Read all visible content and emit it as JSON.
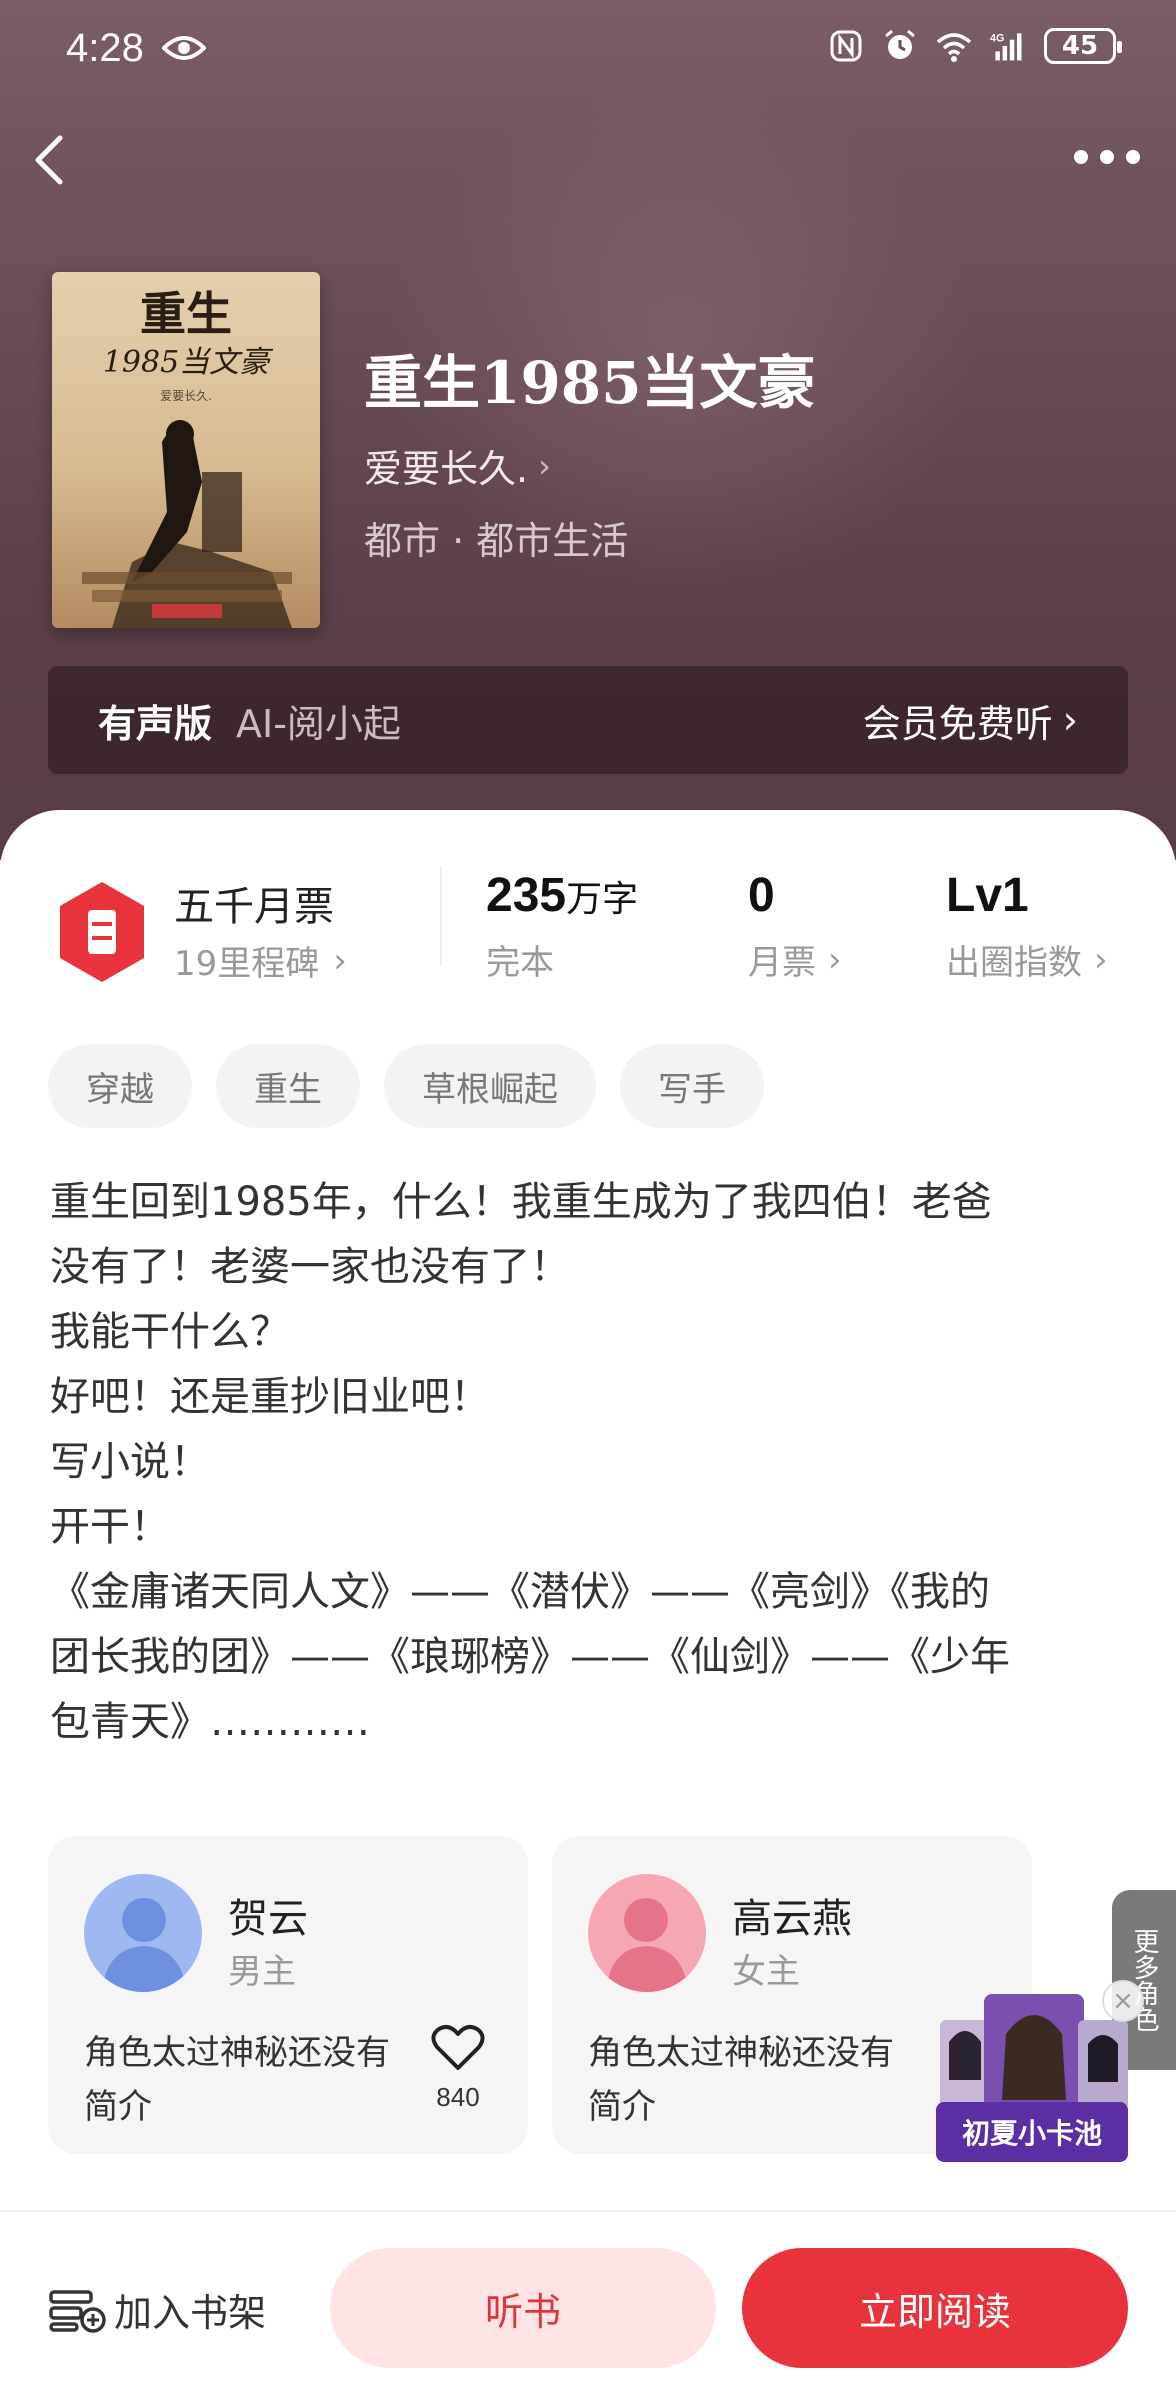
{
  "status_bar": {
    "time": "4:28",
    "battery": "45",
    "icons": [
      "eye-icon",
      "nfc-icon",
      "alarm-icon",
      "wifi-icon",
      "signal-4g-icon",
      "battery-icon"
    ]
  },
  "nav": {
    "back_icon": "chevron-left-icon",
    "more_icon": "more-dots-icon"
  },
  "book": {
    "title": "重生1985当文豪",
    "author": "爱要长久.",
    "category": "都市 · 都市生活",
    "cover_text": "重生 1985当文豪"
  },
  "audio": {
    "label": "有声版",
    "narrator": "AI-阅小起",
    "action": "会员免费听"
  },
  "stats": {
    "ticket_title": "五千月票",
    "ticket_sub": "19里程碑",
    "words_value": "235",
    "words_unit": "万字",
    "words_label": "完本",
    "monthly_value": "0",
    "monthly_label": "月票",
    "level_value": "Lv1",
    "level_label": "出圈指数"
  },
  "tags": [
    "穿越",
    "重生",
    "草根崛起",
    "写手"
  ],
  "synopsis": [
    "重生回到1985年，什么！我重生成为了我四伯！老爸",
    "没有了！老婆一家也没有了！",
    "我能干什么？",
    "好吧！还是重抄旧业吧！",
    "写小说！",
    "开干！",
    "《金庸诸天同人文》——《潜伏》——《亮剑》《我的",
    "团长我的团》——《琅琊榜》——《仙剑》——《少年",
    "包青天》…………"
  ],
  "characters": [
    {
      "name": "贺云",
      "role": "男主",
      "desc": "角色太过神秘还没有简介",
      "likes": "840"
    },
    {
      "name": "高云燕",
      "role": "女主",
      "desc": "角色太过神秘还没有简介"
    }
  ],
  "more_roles": "更多角色",
  "card_pool": "初夏小卡池",
  "bottom": {
    "shelf": "加入书架",
    "listen": "听书",
    "read": "立即阅读"
  },
  "colors": {
    "accent_red": "#e8333c",
    "listen_bg": "#fde3e3",
    "hero_bg": "#5c3f49",
    "pool_purple": "#5b2fa3"
  }
}
